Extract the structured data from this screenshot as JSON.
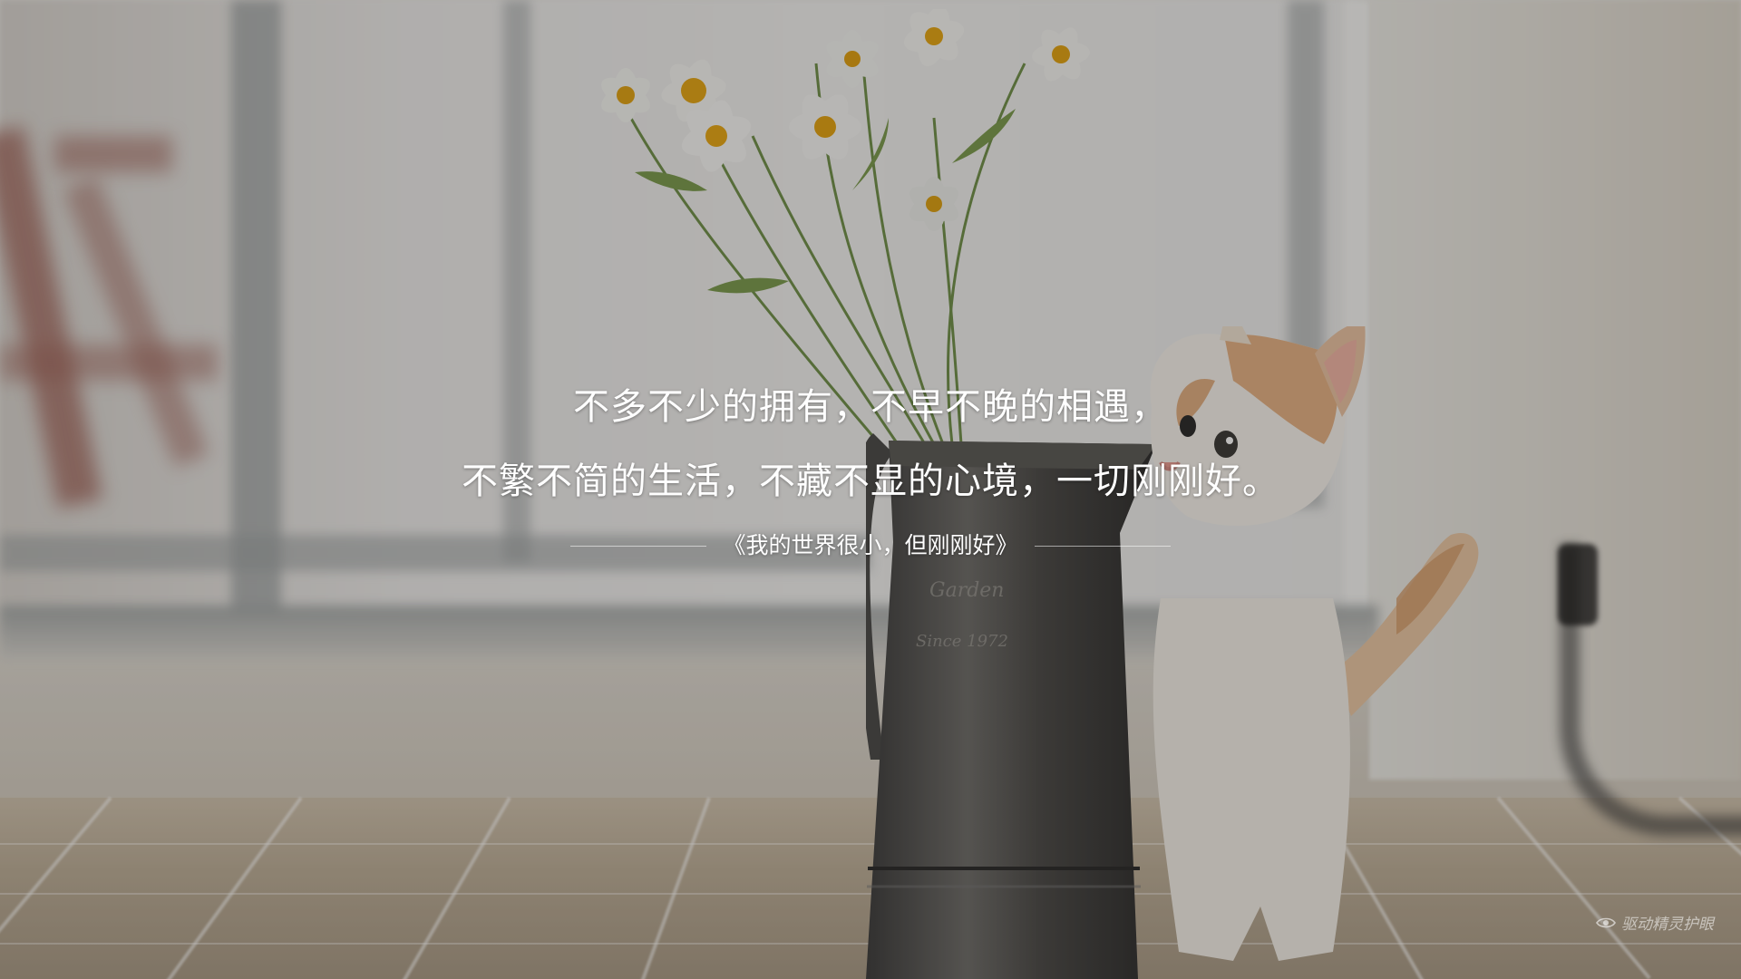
{
  "screen": {
    "type": "lock-screen-wallpaper"
  },
  "quote": {
    "line1": "不多不少的拥有，不早不晚的相遇，",
    "line2": "不繁不简的生活，不藏不显的心境，一切刚刚好。",
    "source": "《我的世界很小，但刚刚好》"
  },
  "background": {
    "subject": "white-and-ginger kitten beside metal pitcher of white cosmos flowers",
    "pitcher_engraving_line1": "Garden",
    "pitcher_engraving_line2": "Since 1972"
  },
  "watermark": {
    "icon": "eye-icon",
    "text": "驱动精灵护眼"
  },
  "colors": {
    "text": "#ffffff",
    "overlay": "rgba(20,18,16,0.28)"
  }
}
